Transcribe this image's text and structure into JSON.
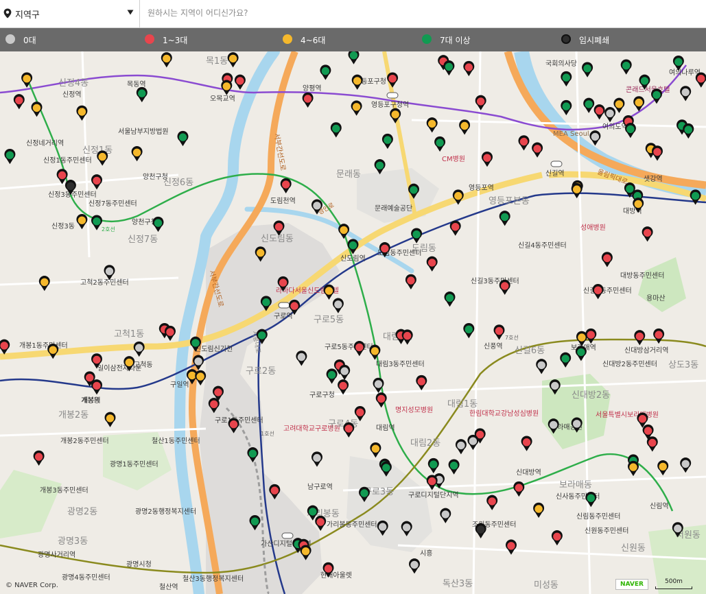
{
  "search": {
    "region_label": "지역구",
    "placeholder": "원하시는 지역이 어디신가요?"
  },
  "legend": [
    {
      "label": "0대",
      "color": "#c9c9c9"
    },
    {
      "label": "1~3대",
      "color": "#e8454d"
    },
    {
      "label": "4~6대",
      "color": "#f5b82c"
    },
    {
      "label": "7대 이상",
      "color": "#119a52"
    },
    {
      "label": "임시폐쇄",
      "color": "#2e2e2e"
    }
  ],
  "colors": {
    "water": "#a8d6ee",
    "road_major": "#f7d872",
    "road_orange": "#f5a95a",
    "park": "#cde7bf",
    "urban": "#e0dfdd",
    "line_purple": "#8a4bd1",
    "line_green": "#2eae4a",
    "line_blue": "#24398b",
    "line_olive": "#8a8a1e"
  },
  "map": {
    "places": [
      "신정역",
      "목동역",
      "오목교역",
      "양평역",
      "영등포구청",
      "영등포구청역",
      "국회의사당",
      "여의나루역",
      "콘래드서울호텔",
      "여의도역",
      "MEA Seoul",
      "신정4동",
      "목1동",
      "문래동",
      "신정1동",
      "신정네거리역",
      "서울남부지방법원",
      "신정1동주민센터",
      "양천구청",
      "신정6동",
      "신정3동주민센터",
      "신정7동주민센터",
      "양천구청역",
      "신정7동",
      "도림천역",
      "신도림동",
      "신도림역",
      "문래예술공단",
      "영등포역",
      "영등포본동",
      "신길역",
      "샛강역",
      "대방역",
      "CM병원",
      "성애병원",
      "도림동",
      "도림동주민센터",
      "신길4동주민센터",
      "대방동주민센터",
      "용마산",
      "고척2동주민센터",
      "라마다서울신도림호텔",
      "구로역",
      "구로5동",
      "신길3동주민센터",
      "신길6동",
      "신길5동주민센터",
      "고척1동",
      "개봉1동주민센터",
      "신풍역",
      "보라매역",
      "신대방삼거리역",
      "상도3동",
      "일이삼전자타운",
      "구일역",
      "신도림신기천",
      "구로2동",
      "대림3동",
      "대림3동주민센터",
      "구로5동주민센터",
      "구로구청",
      "개봉역",
      "신대방2동주민센터",
      "신대방2동",
      "대림1동",
      "한림대학교강남성심병원",
      "명지성모병원",
      "보라매공원",
      "서울특별시보라매병원",
      "개봉2동",
      "구로1동주민센터",
      "고려대학교구로병원",
      "구로4동",
      "대림역",
      "개봉2동주민센터",
      "철산1동주민센터",
      "광명1동주민센터",
      "대림2동",
      "신대방역",
      "보라매동",
      "신림동주민센터",
      "개봉3동주민센터",
      "남구로역",
      "구로3동",
      "구로디지털단지역",
      "신사동주민센터",
      "신림역",
      "광명2동",
      "광명2동행정복지센터",
      "가리봉동",
      "가리봉동주민센터",
      "조원동주민센터",
      "신원동주민센터",
      "서원동",
      "광명사거리역",
      "광명3동",
      "가산디지털단지역",
      "시흥",
      "신원동",
      "광명시청",
      "광명4동주민센터",
      "철산3동행정복지센터",
      "철산역",
      "현대아울렛",
      "독산3동",
      "미성동",
      "신정3동",
      "고척동",
      "개봉동"
    ],
    "road_labels": [
      "서부간선도로",
      "서부간선도로",
      "올림픽대로",
      "경인로",
      "시흥대로",
      "7호선",
      "2호선",
      "1호선"
    ],
    "markers": [
      {
        "cat": 2,
        "x": 0.038,
        "y": 0.054
      },
      {
        "cat": 1,
        "x": 0.027,
        "y": 0.094
      },
      {
        "cat": 2,
        "x": 0.052,
        "y": 0.108
      },
      {
        "cat": 2,
        "x": 0.116,
        "y": 0.115
      },
      {
        "cat": 3,
        "x": 0.201,
        "y": 0.081
      },
      {
        "cat": 2,
        "x": 0.33,
        "y": 0.017
      },
      {
        "cat": 1,
        "x": 0.322,
        "y": 0.055
      },
      {
        "cat": 1,
        "x": 0.34,
        "y": 0.058
      },
      {
        "cat": 2,
        "x": 0.321,
        "y": 0.068
      },
      {
        "cat": 3,
        "x": 0.461,
        "y": 0.04
      },
      {
        "cat": 2,
        "x": 0.506,
        "y": 0.058
      },
      {
        "cat": 3,
        "x": 0.501,
        "y": 0.011
      },
      {
        "cat": 1,
        "x": 0.436,
        "y": 0.091
      },
      {
        "cat": 2,
        "x": 0.505,
        "y": 0.106
      },
      {
        "cat": 3,
        "x": 0.476,
        "y": 0.146
      },
      {
        "cat": 1,
        "x": 0.556,
        "y": 0.054
      },
      {
        "cat": 2,
        "x": 0.56,
        "y": 0.12
      },
      {
        "cat": 1,
        "x": 0.628,
        "y": 0.022
      },
      {
        "cat": 3,
        "x": 0.636,
        "y": 0.032
      },
      {
        "cat": 1,
        "x": 0.664,
        "y": 0.033
      },
      {
        "cat": 1,
        "x": 0.681,
        "y": 0.096
      },
      {
        "cat": 2,
        "x": 0.612,
        "y": 0.137
      },
      {
        "cat": 2,
        "x": 0.658,
        "y": 0.141
      },
      {
        "cat": 3,
        "x": 0.549,
        "y": 0.167
      },
      {
        "cat": 3,
        "x": 0.623,
        "y": 0.172
      },
      {
        "cat": 1,
        "x": 0.69,
        "y": 0.2
      },
      {
        "cat": 1,
        "x": 0.742,
        "y": 0.17
      },
      {
        "cat": 1,
        "x": 0.761,
        "y": 0.183
      },
      {
        "cat": 3,
        "x": 0.538,
        "y": 0.214
      },
      {
        "cat": 2,
        "x": 0.194,
        "y": 0.19
      },
      {
        "cat": 3,
        "x": 0.259,
        "y": 0.162
      },
      {
        "cat": 2,
        "x": 0.236,
        "y": 0.017
      },
      {
        "cat": 3,
        "x": 0.014,
        "y": 0.195
      },
      {
        "cat": 1,
        "x": 0.088,
        "y": 0.232
      },
      {
        "cat": 4,
        "x": 0.1,
        "y": 0.252
      },
      {
        "cat": 1,
        "x": 0.137,
        "y": 0.242
      },
      {
        "cat": 2,
        "x": 0.145,
        "y": 0.198
      },
      {
        "cat": 2,
        "x": 0.116,
        "y": 0.315
      },
      {
        "cat": 3,
        "x": 0.137,
        "y": 0.317
      },
      {
        "cat": 3,
        "x": 0.224,
        "y": 0.32
      },
      {
        "cat": 1,
        "x": 0.405,
        "y": 0.249
      },
      {
        "cat": 0,
        "x": 0.449,
        "y": 0.288
      },
      {
        "cat": 3,
        "x": 0.586,
        "y": 0.259
      },
      {
        "cat": 2,
        "x": 0.649,
        "y": 0.27
      },
      {
        "cat": 3,
        "x": 0.715,
        "y": 0.309
      },
      {
        "cat": 1,
        "x": 0.645,
        "y": 0.327
      },
      {
        "cat": 1,
        "x": 0.395,
        "y": 0.327
      },
      {
        "cat": 2,
        "x": 0.369,
        "y": 0.375
      },
      {
        "cat": 2,
        "x": 0.487,
        "y": 0.333
      },
      {
        "cat": 3,
        "x": 0.5,
        "y": 0.361
      },
      {
        "cat": 1,
        "x": 0.545,
        "y": 0.367
      },
      {
        "cat": 3,
        "x": 0.59,
        "y": 0.341
      },
      {
        "cat": 1,
        "x": 0.612,
        "y": 0.393
      },
      {
        "cat": 1,
        "x": 0.582,
        "y": 0.426
      },
      {
        "cat": 3,
        "x": 0.637,
        "y": 0.458
      },
      {
        "cat": 1,
        "x": 0.715,
        "y": 0.436
      },
      {
        "cat": 0,
        "x": 0.155,
        "y": 0.409
      },
      {
        "cat": 2,
        "x": 0.063,
        "y": 0.429
      },
      {
        "cat": 1,
        "x": 0.401,
        "y": 0.43
      },
      {
        "cat": 2,
        "x": 0.466,
        "y": 0.445
      },
      {
        "cat": 1,
        "x": 0.417,
        "y": 0.473
      },
      {
        "cat": 3,
        "x": 0.377,
        "y": 0.466
      },
      {
        "cat": 0,
        "x": 0.479,
        "y": 0.47
      },
      {
        "cat": 1,
        "x": 0.86,
        "y": 0.385
      },
      {
        "cat": 1,
        "x": 0.917,
        "y": 0.338
      },
      {
        "cat": 1,
        "x": 0.847,
        "y": 0.444
      },
      {
        "cat": 2,
        "x": 0.818,
        "y": 0.253
      },
      {
        "cat": 3,
        "x": 0.892,
        "y": 0.257
      },
      {
        "cat": 3,
        "x": 0.903,
        "y": 0.27
      },
      {
        "cat": 2,
        "x": 0.904,
        "y": 0.285
      },
      {
        "cat": 3,
        "x": 0.985,
        "y": 0.27
      },
      {
        "cat": 3,
        "x": 0.832,
        "y": 0.035
      },
      {
        "cat": 3,
        "x": 0.802,
        "y": 0.052
      },
      {
        "cat": 3,
        "x": 0.887,
        "y": 0.03
      },
      {
        "cat": 3,
        "x": 0.913,
        "y": 0.058
      },
      {
        "cat": 3,
        "x": 0.834,
        "y": 0.101
      },
      {
        "cat": 1,
        "x": 0.849,
        "y": 0.113
      },
      {
        "cat": 0,
        "x": 0.864,
        "y": 0.118
      },
      {
        "cat": 2,
        "x": 0.877,
        "y": 0.101
      },
      {
        "cat": 2,
        "x": 0.905,
        "y": 0.098
      },
      {
        "cat": 1,
        "x": 0.89,
        "y": 0.133
      },
      {
        "cat": 3,
        "x": 0.893,
        "y": 0.147
      },
      {
        "cat": 0,
        "x": 0.843,
        "y": 0.161
      },
      {
        "cat": 2,
        "x": 0.922,
        "y": 0.184
      },
      {
        "cat": 1,
        "x": 0.931,
        "y": 0.189
      },
      {
        "cat": 3,
        "x": 0.966,
        "y": 0.141
      },
      {
        "cat": 3,
        "x": 0.975,
        "y": 0.148
      },
      {
        "cat": 3,
        "x": 0.961,
        "y": 0.023
      },
      {
        "cat": 1,
        "x": 0.993,
        "y": 0.054
      },
      {
        "cat": 0,
        "x": 0.971,
        "y": 0.079
      },
      {
        "cat": 3,
        "x": 0.93,
        "y": 0.084
      },
      {
        "cat": 3,
        "x": 0.802,
        "y": 0.105
      },
      {
        "cat": 2,
        "x": 0.817,
        "y": 0.258
      },
      {
        "cat": 1,
        "x": 0.233,
        "y": 0.516
      },
      {
        "cat": 1,
        "x": 0.241,
        "y": 0.521
      },
      {
        "cat": 3,
        "x": 0.277,
        "y": 0.541
      },
      {
        "cat": 0,
        "x": 0.281,
        "y": 0.575
      },
      {
        "cat": 0,
        "x": 0.197,
        "y": 0.55
      },
      {
        "cat": 2,
        "x": 0.183,
        "y": 0.577
      },
      {
        "cat": 2,
        "x": 0.075,
        "y": 0.554
      },
      {
        "cat": 1,
        "x": 0.137,
        "y": 0.572
      },
      {
        "cat": 2,
        "x": 0.272,
        "y": 0.601
      },
      {
        "cat": 2,
        "x": 0.284,
        "y": 0.603
      },
      {
        "cat": 1,
        "x": 0.127,
        "y": 0.605
      },
      {
        "cat": 1,
        "x": 0.137,
        "y": 0.62
      },
      {
        "cat": 1,
        "x": 0.006,
        "y": 0.546
      },
      {
        "cat": 1,
        "x": 0.309,
        "y": 0.632
      },
      {
        "cat": 1,
        "x": 0.303,
        "y": 0.654
      },
      {
        "cat": 2,
        "x": 0.156,
        "y": 0.68
      },
      {
        "cat": 1,
        "x": 0.331,
        "y": 0.691
      },
      {
        "cat": 1,
        "x": 0.055,
        "y": 0.751
      },
      {
        "cat": 3,
        "x": 0.358,
        "y": 0.745
      },
      {
        "cat": 0,
        "x": 0.449,
        "y": 0.753
      },
      {
        "cat": 1,
        "x": 0.509,
        "y": 0.549
      },
      {
        "cat": 2,
        "x": 0.531,
        "y": 0.556
      },
      {
        "cat": 1,
        "x": 0.568,
        "y": 0.527
      },
      {
        "cat": 1,
        "x": 0.577,
        "y": 0.528
      },
      {
        "cat": 1,
        "x": 0.481,
        "y": 0.583
      },
      {
        "cat": 0,
        "x": 0.488,
        "y": 0.593
      },
      {
        "cat": 3,
        "x": 0.47,
        "y": 0.6
      },
      {
        "cat": 1,
        "x": 0.486,
        "y": 0.62
      },
      {
        "cat": 0,
        "x": 0.536,
        "y": 0.617
      },
      {
        "cat": 1,
        "x": 0.597,
        "y": 0.612
      },
      {
        "cat": 1,
        "x": 0.54,
        "y": 0.644
      },
      {
        "cat": 1,
        "x": 0.51,
        "y": 0.669
      },
      {
        "cat": 1,
        "x": 0.494,
        "y": 0.699
      },
      {
        "cat": 0,
        "x": 0.427,
        "y": 0.567
      },
      {
        "cat": 2,
        "x": 0.532,
        "y": 0.736
      },
      {
        "cat": 3,
        "x": 0.545,
        "y": 0.766
      },
      {
        "cat": 3,
        "x": 0.547,
        "y": 0.771
      },
      {
        "cat": 3,
        "x": 0.614,
        "y": 0.765
      },
      {
        "cat": 3,
        "x": 0.643,
        "y": 0.767
      },
      {
        "cat": 0,
        "x": 0.622,
        "y": 0.793
      },
      {
        "cat": 1,
        "x": 0.612,
        "y": 0.796
      },
      {
        "cat": 1,
        "x": 0.68,
        "y": 0.71
      },
      {
        "cat": 0,
        "x": 0.67,
        "y": 0.722
      },
      {
        "cat": 0,
        "x": 0.653,
        "y": 0.73
      },
      {
        "cat": 1,
        "x": 0.707,
        "y": 0.519
      },
      {
        "cat": 3,
        "x": 0.664,
        "y": 0.516
      },
      {
        "cat": 1,
        "x": 0.837,
        "y": 0.526
      },
      {
        "cat": 2,
        "x": 0.824,
        "y": 0.531
      },
      {
        "cat": 3,
        "x": 0.823,
        "y": 0.558
      },
      {
        "cat": 3,
        "x": 0.801,
        "y": 0.57
      },
      {
        "cat": 0,
        "x": 0.767,
        "y": 0.582
      },
      {
        "cat": 1,
        "x": 0.906,
        "y": 0.529
      },
      {
        "cat": 1,
        "x": 0.933,
        "y": 0.526
      },
      {
        "cat": 0,
        "x": 0.786,
        "y": 0.62
      },
      {
        "cat": 0,
        "x": 0.784,
        "y": 0.692
      },
      {
        "cat": 0,
        "x": 0.817,
        "y": 0.69
      },
      {
        "cat": 1,
        "x": 0.746,
        "y": 0.724
      },
      {
        "cat": 1,
        "x": 0.91,
        "y": 0.681
      },
      {
        "cat": 1,
        "x": 0.918,
        "y": 0.703
      },
      {
        "cat": 1,
        "x": 0.924,
        "y": 0.725
      },
      {
        "cat": 3,
        "x": 0.897,
        "y": 0.758
      },
      {
        "cat": 2,
        "x": 0.897,
        "y": 0.77
      },
      {
        "cat": 2,
        "x": 0.939,
        "y": 0.769
      },
      {
        "cat": 0,
        "x": 0.971,
        "y": 0.764
      },
      {
        "cat": 3,
        "x": 0.837,
        "y": 0.827
      },
      {
        "cat": 1,
        "x": 0.735,
        "y": 0.808
      },
      {
        "cat": 1,
        "x": 0.697,
        "y": 0.833
      },
      {
        "cat": 2,
        "x": 0.763,
        "y": 0.847
      },
      {
        "cat": 1,
        "x": 0.389,
        "y": 0.813
      },
      {
        "cat": 3,
        "x": 0.443,
        "y": 0.852
      },
      {
        "cat": 1,
        "x": 0.454,
        "y": 0.871
      },
      {
        "cat": 3,
        "x": 0.516,
        "y": 0.818
      },
      {
        "cat": 0,
        "x": 0.631,
        "y": 0.857
      },
      {
        "cat": 3,
        "x": 0.361,
        "y": 0.87
      },
      {
        "cat": 0,
        "x": 0.542,
        "y": 0.88
      },
      {
        "cat": 0,
        "x": 0.576,
        "y": 0.881
      },
      {
        "cat": 4,
        "x": 0.681,
        "y": 0.885
      },
      {
        "cat": 1,
        "x": 0.789,
        "y": 0.898
      },
      {
        "cat": 0,
        "x": 0.96,
        "y": 0.883
      },
      {
        "cat": 3,
        "x": 0.422,
        "y": 0.912
      },
      {
        "cat": 1,
        "x": 0.43,
        "y": 0.914
      },
      {
        "cat": 2,
        "x": 0.433,
        "y": 0.925
      },
      {
        "cat": 1,
        "x": 0.724,
        "y": 0.915
      },
      {
        "cat": 0,
        "x": 0.587,
        "y": 0.95
      },
      {
        "cat": 1,
        "x": 0.465,
        "y": 0.957
      },
      {
        "cat": 3,
        "x": 0.371,
        "y": 0.527
      }
    ]
  }
}
